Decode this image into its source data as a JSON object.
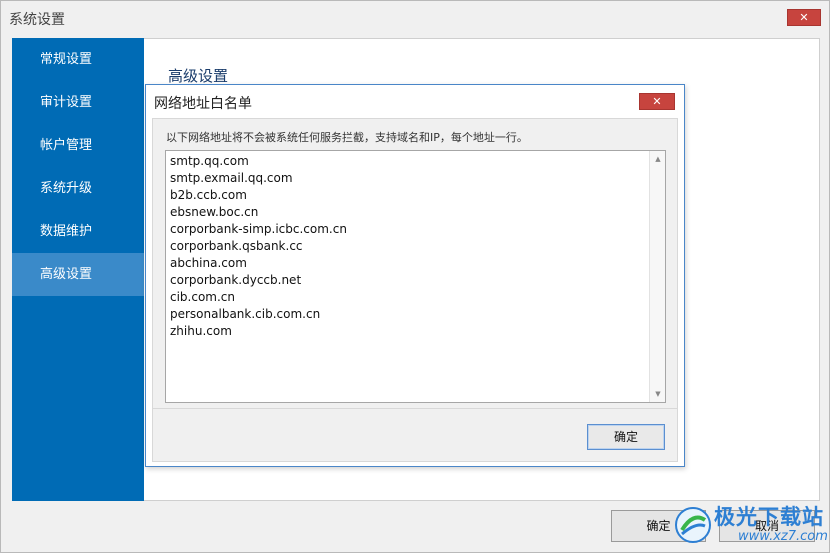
{
  "window": {
    "title": "系统设置",
    "close_label": "✕"
  },
  "sidebar": {
    "items": [
      {
        "label": "常规设置"
      },
      {
        "label": "审计设置"
      },
      {
        "label": "帐户管理"
      },
      {
        "label": "系统升级"
      },
      {
        "label": "数据维护"
      },
      {
        "label": "高级设置",
        "active": true
      }
    ]
  },
  "content": {
    "title": "高级设置"
  },
  "footer": {
    "ok_label": "确定",
    "cancel_label": "取消"
  },
  "dialog": {
    "title": "网络地址白名单",
    "close_label": "✕",
    "description": "以下网络地址将不会被系统任何服务拦截，支持域名和IP，每个地址一行。",
    "addresses": [
      "smtp.qq.com",
      "smtp.exmail.qq.com",
      "b2b.ccb.com",
      "ebsnew.boc.cn",
      "corporbank-simp.icbc.com.cn",
      "corporbank.qsbank.cc",
      "abchina.com",
      "corporbank.dyccb.net",
      "cib.com.cn",
      "personalbank.cib.com.cn",
      "zhihu.com"
    ],
    "ok_label": "确定"
  },
  "watermark": {
    "text": "极光下载站",
    "url": "www.xz7.com"
  },
  "colors": {
    "sidebar": "#006bb5",
    "sidebar_active": "#3a8ac9",
    "close": "#c7443e",
    "dialog_border": "#4a86c8"
  }
}
